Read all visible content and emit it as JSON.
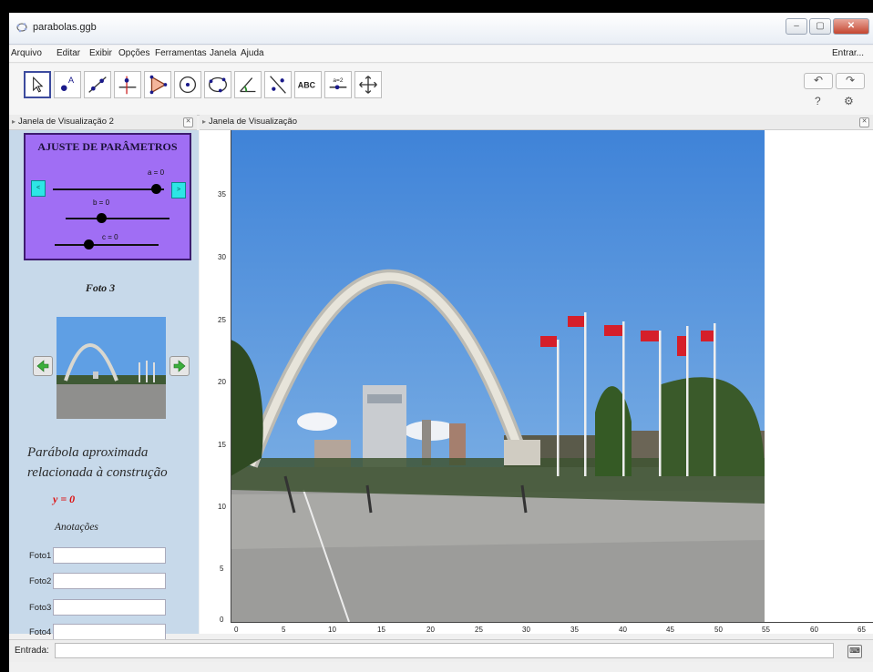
{
  "window": {
    "title": "parabolas.ggb",
    "controls": {
      "minimize": "–",
      "maximize": "▢",
      "close": "✕"
    }
  },
  "menu": {
    "items": [
      "Arquivo",
      "Editar",
      "Exibir",
      "Opções",
      "Ferramentas",
      "Janela",
      "Ajuda"
    ],
    "login": "Entrar..."
  },
  "toolbar": {
    "tools": [
      "move-tool",
      "point-tool",
      "line-tool",
      "perpendicular-tool",
      "polygon-tool",
      "circle-tool",
      "conic-tool",
      "angle-tool",
      "reflect-tool",
      "text-tool",
      "slider-tool",
      "move-view-tool"
    ],
    "text_tool_label": "ABC",
    "slider_tool_label": "a=2",
    "undo": "↶",
    "redo": "↷",
    "help": "?",
    "settings": "⚙"
  },
  "left_panel": {
    "header": "Janela de Visualização 2",
    "params_title": "AJUSTE DE PARÂMETROS",
    "sliders": [
      {
        "label": "a = 0",
        "value": 0
      },
      {
        "label": "b = 0",
        "value": 0
      },
      {
        "label": "c = 0",
        "value": 0
      }
    ],
    "decrease_label": "<",
    "increase_label": ">",
    "photo_title": "Foto 3",
    "description": "Parábola aproximada relacionada à construção",
    "equation": "y = 0",
    "notes_title": "Anotações",
    "notes": [
      {
        "label": "Foto1",
        "value": ""
      },
      {
        "label": "Foto2",
        "value": ""
      },
      {
        "label": "Foto3",
        "value": ""
      },
      {
        "label": "Foto4",
        "value": ""
      }
    ]
  },
  "graphics": {
    "header": "Janela de Visualização",
    "y_ticks": [
      "35",
      "30",
      "25",
      "20",
      "15",
      "10",
      "5",
      "0"
    ],
    "x_ticks": [
      "0",
      "5",
      "10",
      "15",
      "20",
      "25",
      "30",
      "35",
      "40",
      "45",
      "50",
      "55",
      "60",
      "65"
    ]
  },
  "input_bar": {
    "label": "Entrada:",
    "value": "",
    "keyboard": "⌨"
  },
  "colors": {
    "params_bg": "#a06ef4",
    "sky": "#4d8fdc",
    "equation": "#dd1111"
  }
}
